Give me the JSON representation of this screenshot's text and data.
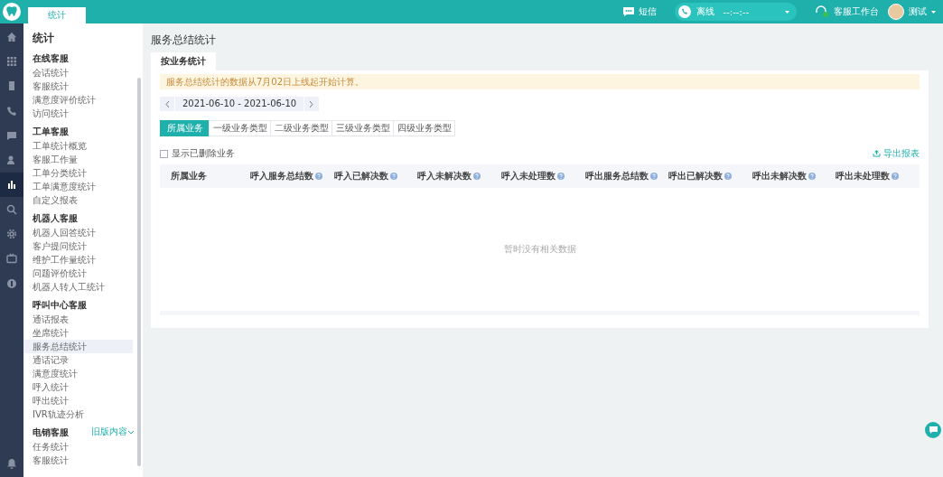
{
  "topbar": {
    "tabs": [
      {
        "label": "统计",
        "selected": true
      }
    ],
    "sms": "短信",
    "phone": {
      "status": "离线",
      "timer": "--:--:--"
    },
    "workbench": "客服工作台",
    "user": "测试"
  },
  "rail": {
    "items": [
      {
        "kind": "home",
        "selected": false
      },
      {
        "kind": "grid",
        "selected": false
      },
      {
        "kind": "doc",
        "selected": false
      },
      {
        "kind": "phone",
        "selected": false
      },
      {
        "kind": "chat",
        "selected": false
      },
      {
        "kind": "person",
        "selected": false
      },
      {
        "kind": "chart",
        "selected": true
      },
      {
        "kind": "search",
        "selected": false
      },
      {
        "kind": "gear",
        "selected": false
      },
      {
        "kind": "tv",
        "selected": false
      },
      {
        "kind": "coin",
        "selected": false
      }
    ]
  },
  "sidebar": {
    "title": "统计",
    "groups": [
      {
        "title": "在线客服",
        "items": [
          {
            "label": "会话统计",
            "selected": false
          },
          {
            "label": "客服统计",
            "selected": false
          },
          {
            "label": "满意度评价统计",
            "selected": false
          },
          {
            "label": "访问统计",
            "selected": false
          }
        ]
      },
      {
        "title": "工单客服",
        "items": [
          {
            "label": "工单统计概览",
            "selected": false
          },
          {
            "label": "客服工作量",
            "selected": false
          },
          {
            "label": "工单分类统计",
            "selected": false
          },
          {
            "label": "工单满意度统计",
            "selected": false
          },
          {
            "label": "自定义报表",
            "selected": false
          }
        ]
      },
      {
        "title": "机器人客服",
        "items": [
          {
            "label": "机器人回答统计",
            "selected": false
          },
          {
            "label": "客户提问统计",
            "selected": false
          },
          {
            "label": "维护工作量统计",
            "selected": false
          },
          {
            "label": "问题评价统计",
            "selected": false
          },
          {
            "label": "机器人转人工统计",
            "selected": false
          }
        ]
      },
      {
        "title": "呼叫中心客服",
        "items": [
          {
            "label": "通话报表",
            "selected": false
          },
          {
            "label": "坐席统计",
            "selected": false
          },
          {
            "label": "服务总结统计",
            "selected": true
          },
          {
            "label": "通话记录",
            "selected": false
          },
          {
            "label": "满意度统计",
            "selected": false
          },
          {
            "label": "呼入统计",
            "selected": false
          },
          {
            "label": "呼出统计",
            "selected": false
          },
          {
            "label": "IVR轨迹分析",
            "selected": false
          }
        ]
      },
      {
        "title": "电销客服",
        "link": "旧版内容",
        "items": [
          {
            "label": "任务统计",
            "selected": false
          },
          {
            "label": "客服统计",
            "selected": false
          }
        ]
      }
    ]
  },
  "page": {
    "title": "服务总结统计",
    "tabs": [
      {
        "label": "按业务统计",
        "selected": true
      }
    ],
    "notice": "服务总结统计的数据从7月02日上线起开始计算。",
    "date_range": "2021-06-10 - 2021-06-10",
    "segments": [
      {
        "label": "所属业务",
        "selected": true
      },
      {
        "label": "一级业务类型",
        "selected": false
      },
      {
        "label": "二级业务类型",
        "selected": false
      },
      {
        "label": "三级业务类型",
        "selected": false
      },
      {
        "label": "四级业务类型",
        "selected": false
      }
    ],
    "show_deleted": {
      "label": "显示已删除业务",
      "checked": false
    },
    "export": "导出报表",
    "table": {
      "columns": [
        {
          "label": "所属业务",
          "help": false
        },
        {
          "label": "呼入服务总结数",
          "help": true
        },
        {
          "label": "呼入已解决数",
          "help": true
        },
        {
          "label": "呼入未解决数",
          "help": true
        },
        {
          "label": "呼入未处理数",
          "help": true
        },
        {
          "label": "呼出服务总结数",
          "help": true
        },
        {
          "label": "呼出已解决数",
          "help": true
        },
        {
          "label": "呼出未解决数",
          "help": true
        },
        {
          "label": "呼出未处理数",
          "help": true
        }
      ],
      "empty_text": "暂时没有相关数据"
    }
  }
}
